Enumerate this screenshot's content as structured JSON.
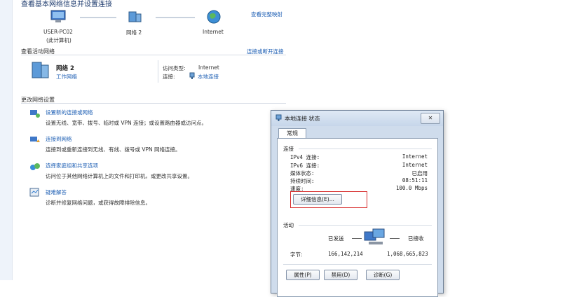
{
  "page": {
    "title": "查看基本网络信息并设置连接",
    "view_full_map": "查看完整映射"
  },
  "map": {
    "pc_name": "USER-PC02",
    "pc_sub": "(此计算机)",
    "network_name": "网络  2",
    "internet": "Internet"
  },
  "active": {
    "header": "查看活动网络",
    "connect_link": "连接或断开连接",
    "network_name": "网络  2",
    "network_type": "工作网络",
    "access_type_label": "访问类型:",
    "access_type_value": "Internet",
    "connection_label": "连接:",
    "connection_value": "本地连接"
  },
  "settings": {
    "header": "更改网络设置",
    "items": [
      {
        "title": "设置新的连接或网络",
        "desc": "设置无线、宽带、拨号、临时或 VPN 连接；或设置路由器或访问点。",
        "icon": "network-setup-icon"
      },
      {
        "title": "连接到网络",
        "desc": "连接到或重新连接到无线、有线、拨号或 VPN 网络连接。",
        "icon": "connect-network-icon"
      },
      {
        "title": "选择家庭组和共享选项",
        "desc": "访问位于其他网络计算机上的文件和打印机，或更改共享设置。",
        "icon": "homegroup-icon"
      },
      {
        "title": "疑难解答",
        "desc": "诊断并修复网络问题，或获得故障排除信息。",
        "icon": "troubleshoot-icon"
      }
    ]
  },
  "dialog": {
    "title": "本地连接 状态",
    "close": "✕",
    "tab": "常规",
    "connection_header": "连接",
    "rows": [
      {
        "label": "IPv4 连接:",
        "value": "Internet"
      },
      {
        "label": "IPv6 连接:",
        "value": "Internet"
      },
      {
        "label": "媒体状态:",
        "value": "已启用"
      },
      {
        "label": "持续时间:",
        "value": "08:51:11"
      },
      {
        "label": "速度:",
        "value": "100.0 Mbps"
      }
    ],
    "details_button": "详细信息(E)...",
    "activity_header": "活动",
    "sent_label": "已发送",
    "received_label": "已接收",
    "bytes_label": "字节:",
    "bytes_sent": "166,142,214",
    "bytes_received": "1,068,665,823",
    "properties_button": "属性(P)",
    "disable_button": "禁用(D)",
    "diagnose_button": "诊断(G)"
  }
}
